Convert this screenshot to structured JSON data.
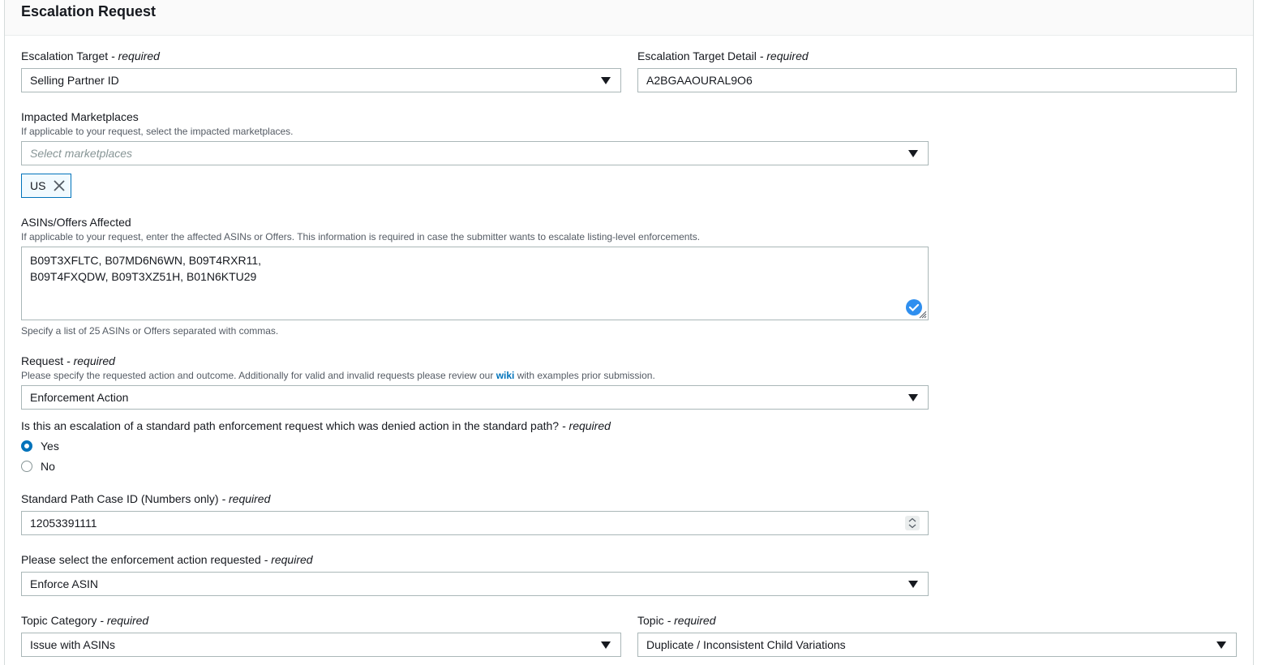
{
  "panel": {
    "title": "Escalation Request"
  },
  "escalation_target": {
    "label": "Escalation Target",
    "required": "- required",
    "value": "Selling Partner ID"
  },
  "escalation_target_detail": {
    "label": "Escalation Target Detail",
    "required": "- required",
    "value": "A2BGAAOURAL9O6"
  },
  "marketplaces": {
    "label": "Impacted Marketplaces",
    "description": "If applicable to your request, select the impacted marketplaces.",
    "placeholder": "Select marketplaces",
    "tokens": [
      "US"
    ]
  },
  "asins": {
    "label": "ASINs/Offers Affected",
    "description": "If applicable to your request, enter the affected ASINs or Offers. This information is required in case the submitter wants to escalate listing-level enforcements.",
    "lines": [
      "B09T3XFLTC, B07MD6N6WN, B09T4RXR11,",
      "B09T4FXQDW, B09T3XZ51H, B01N6KTU29"
    ],
    "hint": "Specify a list of 25 ASINs or Offers separated with commas."
  },
  "request": {
    "label": "Request",
    "required": "- required",
    "description_before": "Please specify the requested action and outcome. Additionally for valid and invalid requests please review our ",
    "link": "wiki",
    "description_after": " with examples prior submission.",
    "value": "Enforcement Action"
  },
  "standard_path_question": {
    "label": "Is this an escalation of a standard path enforcement request which was denied action in the standard path?",
    "required": "- required",
    "options": [
      "Yes",
      "No"
    ],
    "selected": "Yes"
  },
  "case_id": {
    "label": "Standard Path Case ID (Numbers only)",
    "required": "- required",
    "value": "12053391111"
  },
  "enforcement_action": {
    "label": "Please select the enforcement action requested",
    "required": "- required",
    "value": "Enforce ASIN"
  },
  "topic_category": {
    "label": "Topic Category",
    "required": "- required",
    "value": "Issue with ASINs"
  },
  "topic": {
    "label": "Topic",
    "required": "- required",
    "value": "Duplicate / Inconsistent Child Variations"
  },
  "colors": {
    "accent": "#0073bb",
    "border": "#aab7b8",
    "text": "#16191f",
    "muted": "#545b64"
  }
}
